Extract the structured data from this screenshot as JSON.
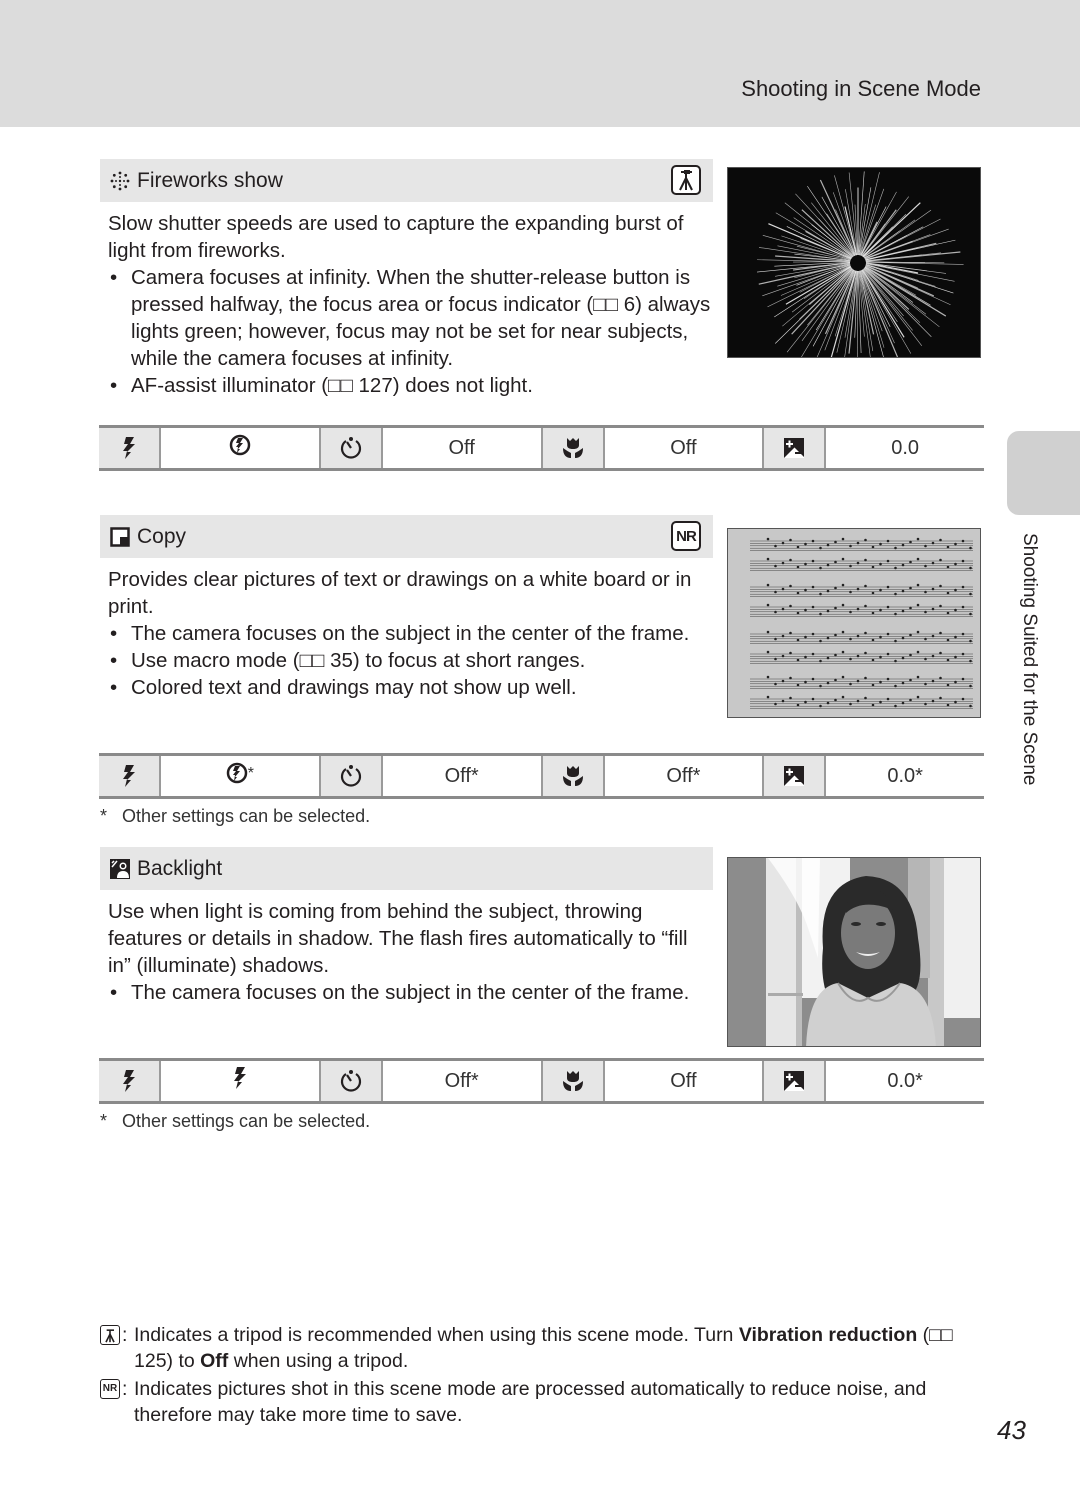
{
  "header": {
    "title": "Shooting in Scene Mode"
  },
  "side_tab": {
    "label": "Shooting Suited for the Scene"
  },
  "sections": [
    {
      "title": "Fireworks show",
      "icon": "fireworks-icon",
      "badge": "tripod-icon",
      "intro": "Slow shutter speeds are used to capture the expanding burst of light from fireworks.",
      "bullets": [
        "Camera focuses at infinity. When the shutter-release button is pressed halfway, the focus area or focus indicator (□□ 6) always lights green; however, focus may not be set for near subjects, while the camera focuses at infinity.",
        "AF-assist illuminator (□□ 127) does not light."
      ],
      "photo": "fireworks-photo",
      "settings": {
        "flash_mode": "flash-off-icon",
        "self_timer": "Off",
        "macro": "Off",
        "exposure_comp": "0.0"
      }
    },
    {
      "title": "Copy",
      "icon": "copy-icon",
      "badge": "NR",
      "intro": "Provides clear pictures of text or drawings on a white board or in print.",
      "bullets": [
        "The camera focuses on the subject in the center of the frame.",
        "Use macro mode (□□ 35) to focus at short ranges.",
        "Colored text and drawings may not show up well."
      ],
      "photo": "sheet-music-photo",
      "settings": {
        "flash_mode": "flash-off-icon",
        "flash_mode_suffix": "*",
        "self_timer": "Off*",
        "macro": "Off*",
        "exposure_comp": "0.0*"
      },
      "footnote": "Other settings can be selected."
    },
    {
      "title": "Backlight",
      "icon": "backlight-icon",
      "intro": "Use when light is coming from behind the subject, throwing features or details in shadow. The flash fires automatically to “fill in” (illuminate) shadows.",
      "bullets": [
        "The camera focuses on the subject in the center of the frame."
      ],
      "photo": "backlit-portrait-photo",
      "settings": {
        "flash_mode": "flash-on-icon",
        "self_timer": "Off*",
        "macro": "Off",
        "exposure_comp": "0.0*"
      },
      "footnote": "Other settings can be selected."
    }
  ],
  "footnote_star": "*",
  "notes": {
    "tripod": {
      "icon_label": "tripod-icon",
      "text_a": "Indicates a tripod is recommended when using this scene mode. Turn ",
      "bold_a": "Vibration reduction",
      "text_b": " (□□ 125) to ",
      "bold_b": "Off",
      "text_c": " when using a tripod."
    },
    "nr": {
      "icon_label": "NR",
      "text": "Indicates pictures shot in this scene mode are processed automatically to reduce noise, and therefore may take more time to save."
    }
  },
  "colon": ":",
  "page_number": "43"
}
